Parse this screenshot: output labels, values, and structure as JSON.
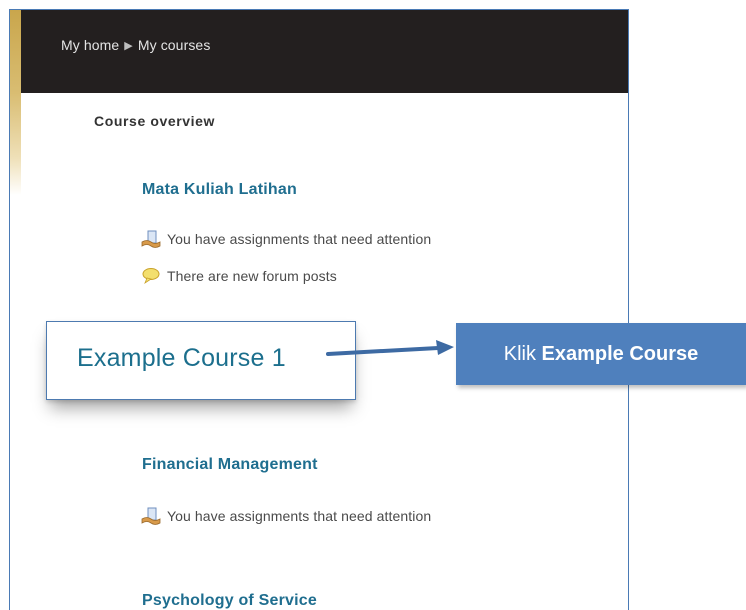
{
  "breadcrumb": {
    "home": "My home",
    "courses": "My courses"
  },
  "section_title": "Course overview",
  "courses": [
    {
      "name": "Mata Kuliah Latihan",
      "notices": [
        {
          "icon": "assignment-icon",
          "text": "You have assignments that need attention"
        },
        {
          "icon": "forum-bubble-icon",
          "text": "There are new forum posts"
        }
      ]
    },
    {
      "name": "Financial Management",
      "notices": [
        {
          "icon": "assignment-icon",
          "text": "You have assignments that need attention"
        }
      ]
    },
    {
      "name": "Psychology of Service",
      "notices": []
    }
  ],
  "callout": {
    "text": "Example Course 1"
  },
  "instruction": {
    "prefix": "Klik ",
    "bold": "Example Course"
  },
  "colors": {
    "topbar": "#231f1f",
    "link": "#1f6e8f",
    "label_bg": "#4f80bd",
    "frame_border": "#4a7ab5"
  }
}
